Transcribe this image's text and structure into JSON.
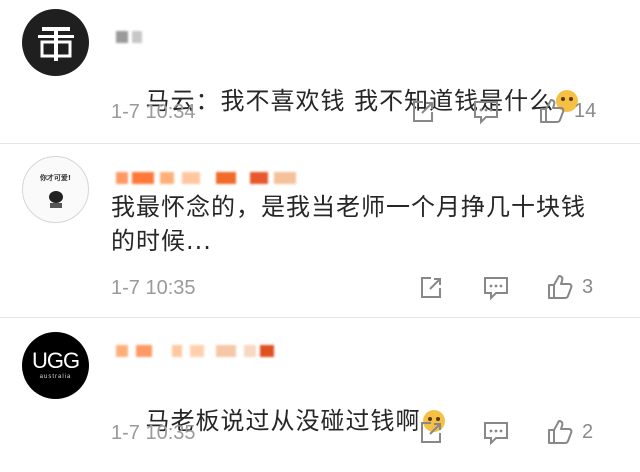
{
  "comments": [
    {
      "text": "马云：我不喜欢钱 我不知道钱是什么",
      "time": "1-7 10:34",
      "likes": "14",
      "emoji": "doge-emoji"
    },
    {
      "text": "我最怀念的，是我当老师一个月挣几十块钱\n的时候...",
      "time": "1-7 10:35",
      "likes": "3",
      "emoji": ""
    },
    {
      "text": "马老板说过从没碰过钱啊",
      "time": "1-7 10:35",
      "likes": "2",
      "emoji": "doge-emoji"
    }
  ],
  "avatars": {
    "c2_text": "你才可爱!",
    "c3_text_top": "UGG",
    "c3_text_bottom": "australia"
  },
  "icons": [
    "share-icon",
    "comment-icon",
    "like-icon"
  ]
}
